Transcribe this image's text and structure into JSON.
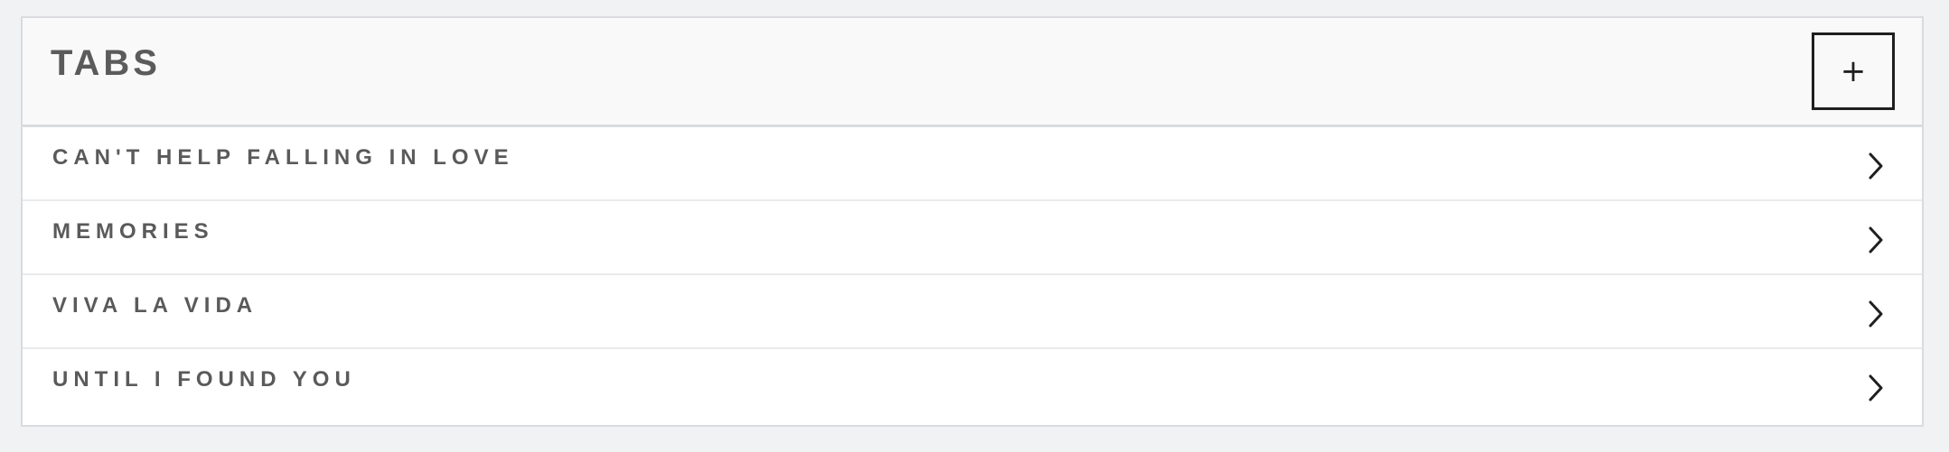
{
  "panel": {
    "title": "TABS",
    "add_button": {
      "label": "+",
      "icon": "plus-icon"
    }
  },
  "tabs": {
    "items": [
      {
        "label": "CAN'T HELP FALLING IN LOVE",
        "icon": "chevron-right-icon"
      },
      {
        "label": "MEMORIES",
        "icon": "chevron-right-icon"
      },
      {
        "label": "VIVA LA VIDA",
        "icon": "chevron-right-icon"
      },
      {
        "label": "UNTIL I FOUND YOU",
        "icon": "chevron-right-icon"
      }
    ]
  },
  "colors": {
    "background": "#f1f2f4",
    "header_background": "#f9f9f9",
    "text": "#5a5a5a",
    "border": "#d9dbde",
    "button_border": "#1f1f1f"
  }
}
